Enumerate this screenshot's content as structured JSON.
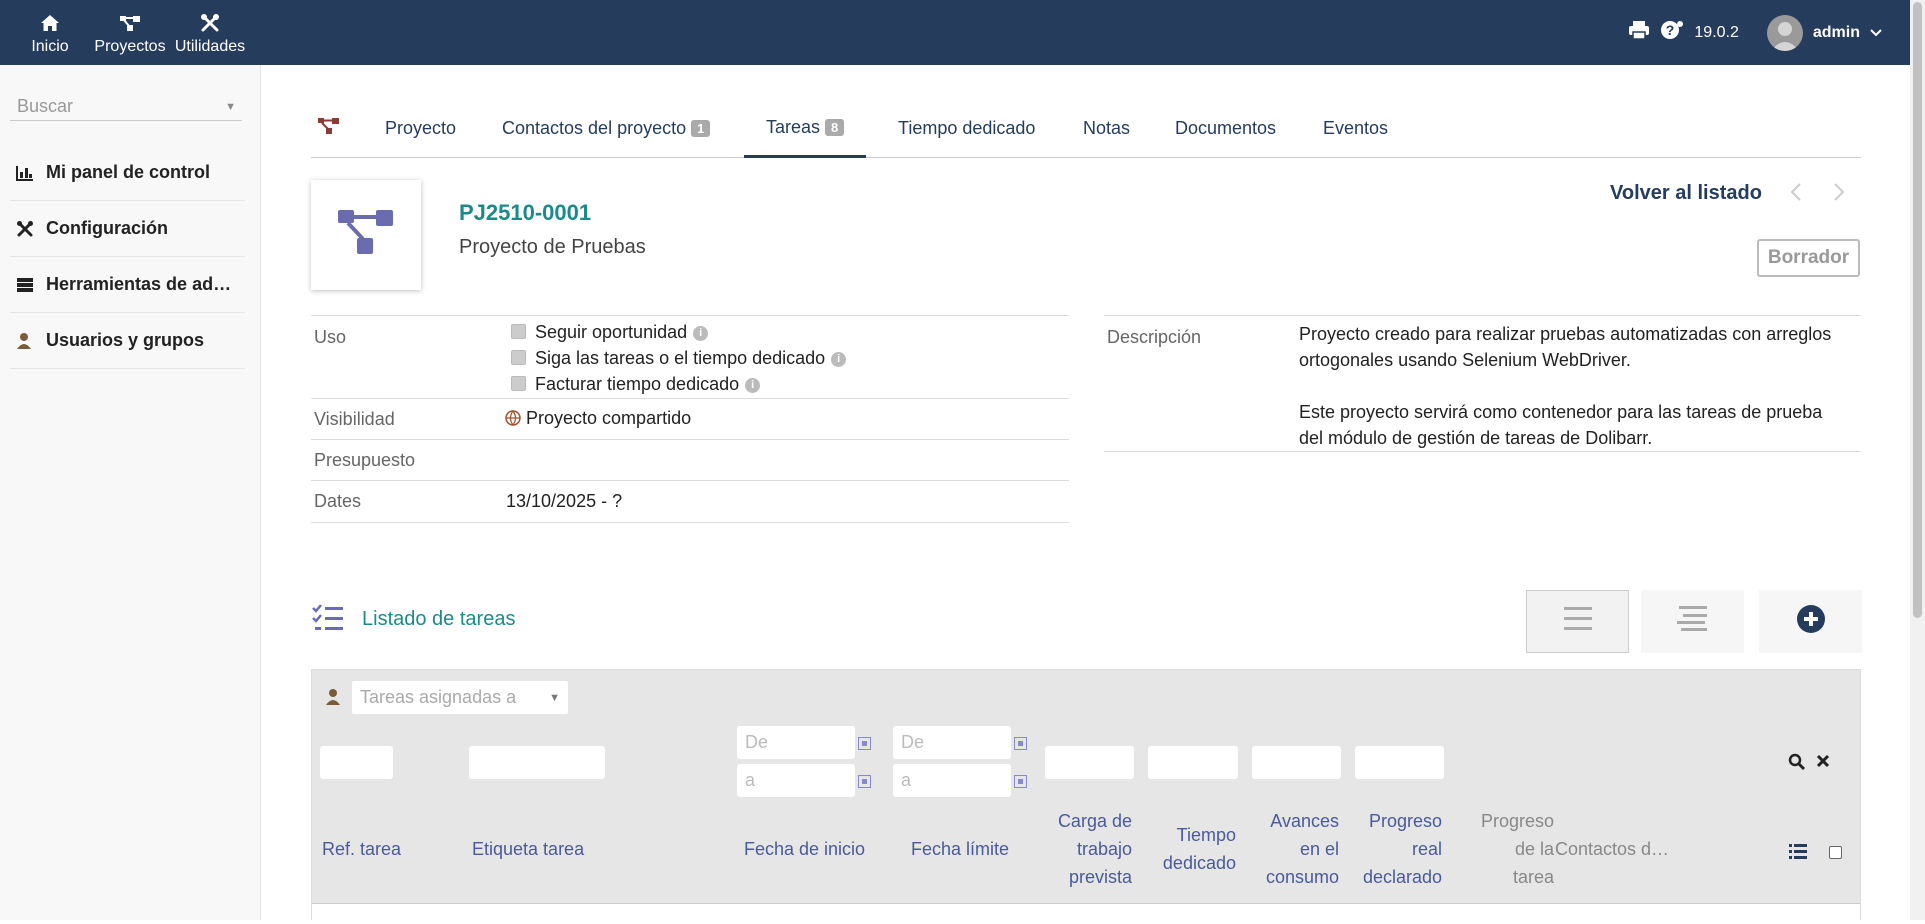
{
  "topbar": {
    "nav": [
      {
        "label": "Inicio",
        "icon": "home-icon"
      },
      {
        "label": "Proyectos",
        "icon": "project-icon"
      },
      {
        "label": "Utilidades",
        "icon": "tools-icon"
      }
    ],
    "version": "19.0.2",
    "user": "admin"
  },
  "leftmenu": {
    "search_placeholder": "Buscar",
    "items": [
      {
        "label": "Mi panel de control",
        "icon": "chart-icon"
      },
      {
        "label": "Configuración",
        "icon": "tools-icon"
      },
      {
        "label": "Herramientas de ad…",
        "icon": "server-icon"
      },
      {
        "label": "Usuarios y grupos",
        "icon": "user-icon"
      }
    ]
  },
  "tabs": [
    {
      "label": "Proyecto"
    },
    {
      "label": "Contactos del proyecto",
      "badge": "1"
    },
    {
      "label": "Tareas",
      "badge": "8"
    },
    {
      "label": "Tiempo dedicado"
    },
    {
      "label": "Notas"
    },
    {
      "label": "Documentos"
    },
    {
      "label": "Eventos"
    }
  ],
  "project": {
    "ref": "PJ2510-0001",
    "label": "Proyecto de Pruebas",
    "back_label": "Volver al listado",
    "status": "Borrador"
  },
  "fields_left": {
    "usage_label": "Uso",
    "usage_options": [
      "Seguir oportunidad",
      "Siga las tareas o el tiempo dedicado",
      "Facturar tiempo dedicado"
    ],
    "visibility_label": "Visibilidad",
    "visibility_value": "Proyecto compartido",
    "budget_label": "Presupuesto",
    "dates_label": "Dates",
    "dates_value": "13/10/2025 - ?"
  },
  "fields_right": {
    "description_label": "Descripción",
    "description_lines": [
      "Proyecto creado para realizar pruebas automatizadas con arreglos",
      "ortogonales usando Selenium WebDriver.",
      "",
      "Este proyecto servirá como contenedor para las tareas de prueba",
      "del módulo de gestión de tareas de Dolibarr."
    ]
  },
  "tasks": {
    "title": "Listado de tareas",
    "assigned_placeholder": "Tareas asignadas a",
    "date_from": "De",
    "date_to": "a",
    "columns": [
      {
        "label": "Ref. tarea"
      },
      {
        "label": "Etiqueta tarea"
      },
      {
        "label": "Fecha de inicio"
      },
      {
        "label": "Fecha límite"
      },
      {
        "lines": [
          "Carga de",
          "trabajo",
          "prevista"
        ]
      },
      {
        "lines": [
          "Tiempo",
          "dedicado"
        ]
      },
      {
        "lines": [
          "Avances",
          "en el",
          "consumo"
        ]
      },
      {
        "lines": [
          "Progreso",
          "real",
          "declarado"
        ]
      },
      {
        "lines": [
          "Progreso",
          "de la",
          "tarea"
        ]
      },
      {
        "label": "Contactos d…"
      }
    ]
  },
  "colors": {
    "topbar": "#263c5c",
    "accent": "#1d8a8a",
    "project_icon": "#6b6baf"
  }
}
